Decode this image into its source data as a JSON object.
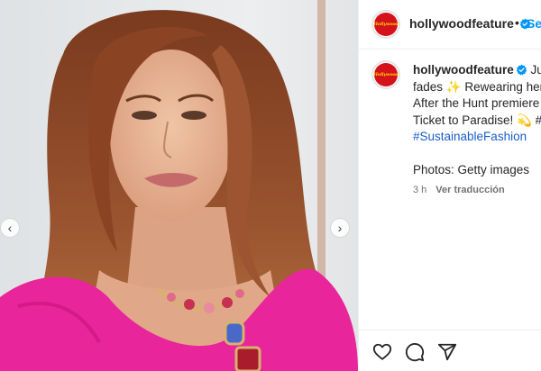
{
  "post": {
    "username": "hollywoodfeature",
    "avatar_text": "Hollywood",
    "follow_label": "Se",
    "separator": "•",
    "caption_lines": [
      "Julia",
      "fades ✨ Rewearing her e",
      "After the Hunt premiere –",
      "Ticket to Paradise! 💫 #Ju",
      "#SustainableFashion"
    ],
    "photos_credit": "Photos: Getty images",
    "time_ago": "3 h",
    "translate_label": "Ver traducción"
  },
  "carousel": {
    "prev": "‹",
    "next": "›"
  },
  "icons": [
    "heart-icon",
    "comment-icon",
    "share-icon",
    "verified-badge-icon",
    "chevron-left-icon",
    "chevron-right-icon"
  ],
  "colors": {
    "accent": "#0095f6",
    "hashtag": "#1a5ec9",
    "dress": "#e8259a",
    "hair": "#8a4a2a",
    "background": "#e9ebec"
  }
}
